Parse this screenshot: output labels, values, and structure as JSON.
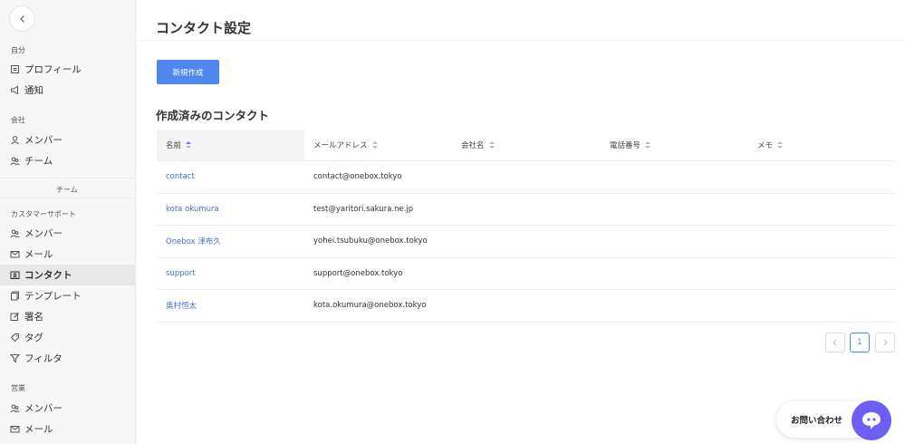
{
  "sidebar": {
    "groups": {
      "self": "自分",
      "company": "会社",
      "support": "カスタマーサポート",
      "sales": "営業"
    },
    "team_sub_label": "チーム",
    "items": {
      "profile": "プロフィール",
      "notifications": "通知",
      "company_members": "メンバー",
      "company_teams": "チーム",
      "support_members": "メンバー",
      "support_mail": "メール",
      "support_contacts": "コンタクト",
      "support_templates": "テンプレート",
      "support_signature": "署名",
      "support_tags": "タグ",
      "support_filters": "フィルタ",
      "sales_members": "メンバー",
      "sales_mail": "メール"
    },
    "active_item": "support_contacts"
  },
  "main": {
    "title": "コンタクト設定",
    "new_button_label": "新規作成",
    "section_title": "作成済みのコンタクト",
    "table": {
      "columns": [
        "名前",
        "メールアドレス",
        "会社名",
        "電話番号",
        "メモ"
      ],
      "rows": [
        {
          "name": "contact",
          "email": "contact@onebox.tokyo",
          "company": "",
          "phone": "",
          "memo": ""
        },
        {
          "name": "kota okumura",
          "email": "test@yaritori.sakura.ne.jp",
          "company": "",
          "phone": "",
          "memo": ""
        },
        {
          "name": "Onebox 津布久",
          "email": "yohei.tsubuku@onebox.tokyo",
          "company": "",
          "phone": "",
          "memo": ""
        },
        {
          "name": "support",
          "email": "support@onebox.tokyo",
          "company": "",
          "phone": "",
          "memo": ""
        },
        {
          "name": "奥村恒太",
          "email": "kota.okumura@onebox.tokyo",
          "company": "",
          "phone": "",
          "memo": ""
        }
      ]
    },
    "pagination": {
      "current_page": "1"
    }
  },
  "widget": {
    "contact_label": "お問い合わせ"
  },
  "colors": {
    "accent": "#4f86f0",
    "chat": "#6e5ef5",
    "link": "#4a6fc7"
  }
}
